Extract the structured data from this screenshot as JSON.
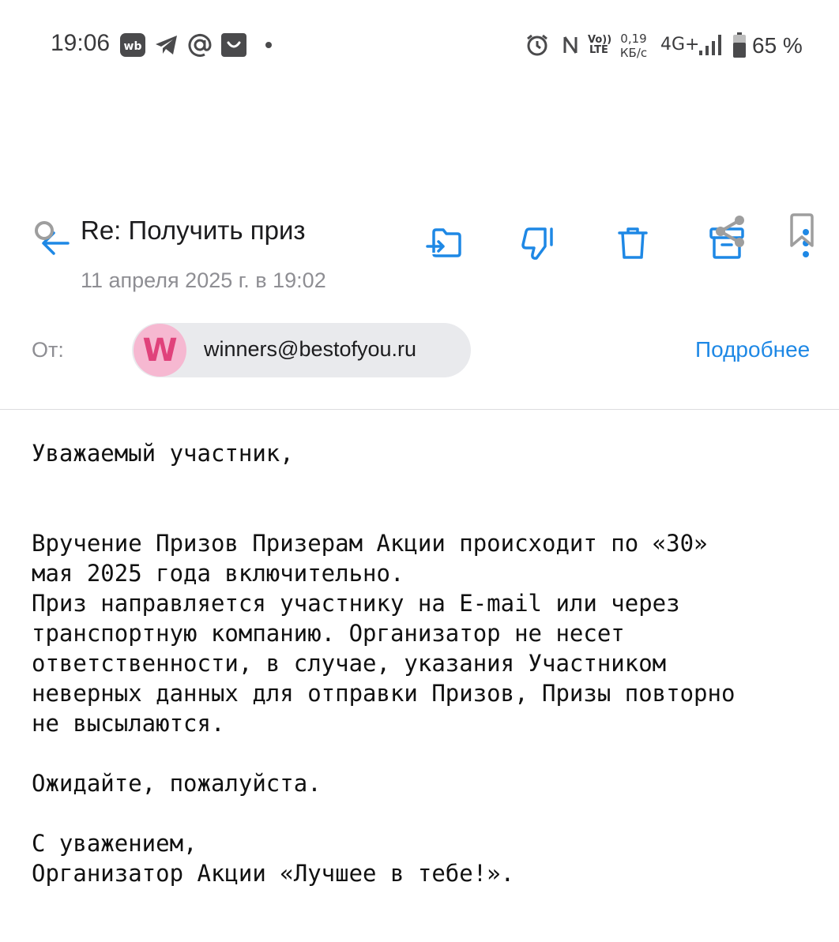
{
  "status_bar": {
    "time": "19:06",
    "net_speed_value": "0,19",
    "net_speed_unit": "КБ/с",
    "network": "4G+",
    "volte_top": "Vo))",
    "volte_bottom": "LTE",
    "battery": "65 %"
  },
  "toolbar": {
    "icons": [
      "back-arrow-icon",
      "move-to-folder-icon",
      "thumbs-down-icon",
      "trash-icon",
      "archive-icon",
      "more-vertical-icon"
    ]
  },
  "message": {
    "subject": "Re: Получить приз",
    "date": "11 апреля 2025 г. в 19:02",
    "from_label": "От:",
    "sender_initial": "W",
    "sender_email": "winners@bestofyou.ru",
    "details_link": "Подробнее",
    "body": {
      "greeting": "Уважаемый участник,",
      "paragraph_lines": [
        "Вручение Призов Призерам Акции происходит по «30»",
        "мая 2025 года включительно.",
        "Приз направляется участнику на E-mail или через",
        "транспортную компанию. Организатор не несет",
        "ответственности, в случае, указания Участником",
        "неверных данных для отправки Призов, Призы повторно",
        "не высылаются."
      ],
      "wait_line": "Ожидайте, пожалуйста.",
      "regards": "С уважением,",
      "signature": "Организатор Акции «Лучшее в тебе!»."
    }
  },
  "colors": {
    "accent": "#1e88e5",
    "avatar_bg": "#f6b8d1",
    "avatar_letter": "#e0427b",
    "chip_bg": "#e9eaed",
    "secondary_text": "#8e8e93"
  }
}
